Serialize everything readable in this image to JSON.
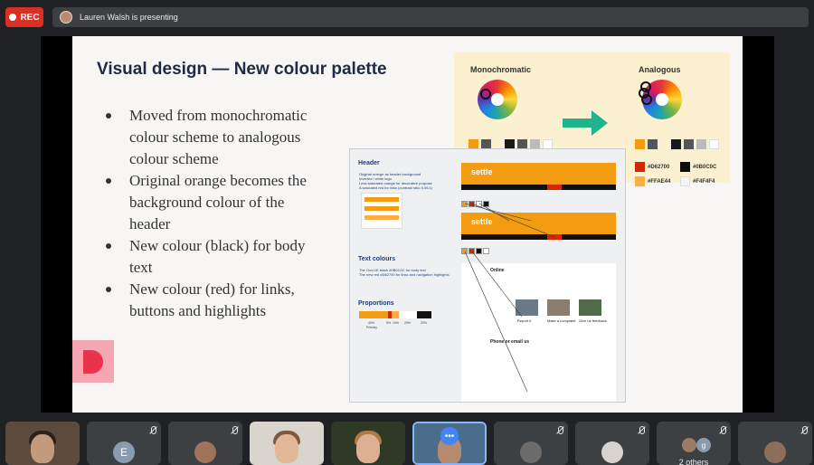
{
  "recording": {
    "label": "REC"
  },
  "presenter": {
    "text": "Lauren Walsh is presenting"
  },
  "slide": {
    "title": "Visual design — New colour palette",
    "bullets": [
      "Moved from monochromatic colour scheme to analogous colour scheme",
      "Original orange becomes the background colour of the header",
      "New colour (black) for body text",
      "New colour (red) for links, buttons and highlights"
    ],
    "palette": {
      "mono_label": "Monochromatic",
      "analog_label": "Analogous",
      "mono_swatches": [
        "#f39c12",
        "#555555",
        "#1a1a1a",
        "#555555",
        "#bbbbbb",
        "#ffffff"
      ],
      "analog_swatches": [
        "#f39c12",
        "#555555",
        "#1a1a1a",
        "#555555",
        "#bbbbbb",
        "#ffffff"
      ],
      "hex_codes": [
        "#D62700",
        "#0B0C0C",
        "#FFAE44",
        "#F4F4F4"
      ],
      "hex_colors": [
        "#d62700",
        "#0b0c0c",
        "#ffae44",
        "#f4f4f4"
      ],
      "arrow_color": "#1fb58c"
    },
    "doc": {
      "header_heading": "Header",
      "header_notes": [
        "Original orange as header background",
        "Inverted / white logo",
        "Less saturated orange for decorative purpose",
        "A saturated red for links (contrast ratio 5.06:1)"
      ],
      "text_colours_heading": "Text colours",
      "text_colours_notes": [
        "The Gov.UK black #0B0C0C for body text",
        "The new red #D62700 for links and navigation highlights"
      ],
      "proportions_heading": "Proportions",
      "proportion_values": [
        "40%",
        "5%",
        "10%",
        "25%",
        "20%"
      ],
      "proportion_primary": "Primary",
      "site_brand": "settle",
      "page_sections": [
        "Online",
        "Phone or email us"
      ],
      "page_buttons": [
        "Report it",
        "Make a complaint",
        "Give us feedback"
      ]
    }
  },
  "participants": [
    {
      "kind": "video",
      "name": "participant-1"
    },
    {
      "kind": "letter",
      "letter": "E"
    },
    {
      "kind": "avatar",
      "name": "participant-3"
    },
    {
      "kind": "video",
      "name": "participant-4"
    },
    {
      "kind": "video",
      "name": "participant-5"
    },
    {
      "kind": "video",
      "name": "participant-6",
      "more": "•••"
    },
    {
      "kind": "avatar",
      "name": "participant-7"
    },
    {
      "kind": "avatar",
      "name": "participant-8"
    },
    {
      "kind": "others",
      "label": "2 others",
      "letter": "g"
    },
    {
      "kind": "avatar",
      "name": "participant-10"
    }
  ]
}
